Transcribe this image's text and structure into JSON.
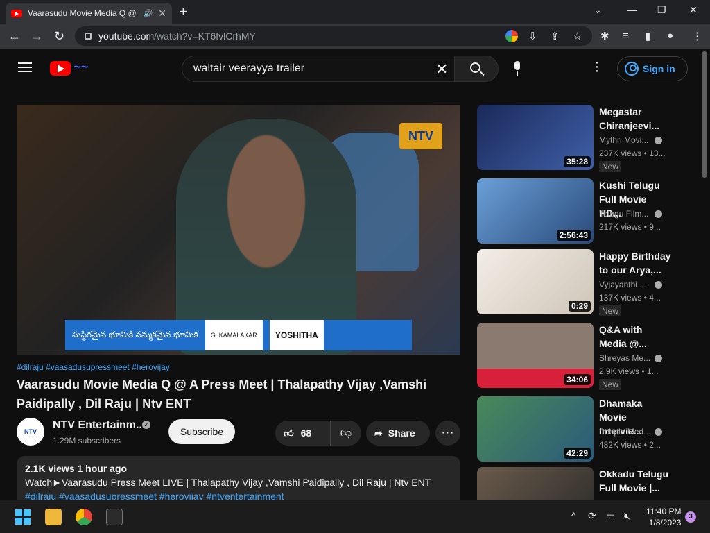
{
  "browser": {
    "tab_title": "Vaarasudu Movie Media Q @",
    "url_host": "youtube.com",
    "url_path": "/watch?v=KT6fvlCrhMY"
  },
  "header": {
    "search_query": "waltair veerayya trailer",
    "sign_in": "Sign in"
  },
  "player": {
    "banner_text": "సుస్థిరమైన భూమికి నమ్మకమైన భూమిక",
    "banner_name": "G. KAMALAKAR",
    "banner_brand": "YOSHITHA",
    "watermark": "NTV"
  },
  "video": {
    "hashtags": "#dilraju #vaasadusupressmeet #herovijay",
    "title": "Vaarasudu Movie Media Q @ A Press Meet | Thalapathy Vijay ,Vamshi Paidipally , Dil Raju | Ntv ENT",
    "channel_name": "NTV Entertainm...",
    "subscribers": "1.29M subscribers",
    "subscribe_label": "Subscribe",
    "likes": "68",
    "share_label": "Share",
    "desc_stats": "2.1K views  1 hour ago",
    "desc_line": "Watch►Vaarasudu Press Meet LIVE |  Thalapathy Vijay ,Vamshi Paidipally , Dil Raju | Ntv ENT",
    "desc_tags": "#dilraju #vaasadusupressmeet #herovijay #ntventertainment"
  },
  "recommendations": [
    {
      "title": "Megastar Chiranjeevi...",
      "channel": "Mythri Movi...",
      "views": "237K views  •  13...",
      "duration": "35:28",
      "badge": "New",
      "thumb_color": "#2b3f7a"
    },
    {
      "title": "Kushi Telugu Full Movie HD...",
      "channel": "Telugu Film...",
      "views": "217K views  •  9...",
      "duration": "2:56:43",
      "badge": "",
      "thumb_color": "#4a7ab8"
    },
    {
      "title": "Happy Birthday to our Arya,...",
      "channel": "Vyjayanthi ...",
      "views": "137K views  •  4...",
      "duration": "0:29",
      "badge": "New",
      "thumb_color": "#e9e4dc"
    },
    {
      "title": "Q&A with Media @...",
      "channel": "Shreyas Me...",
      "views": "2.9K views  •  1...",
      "duration": "34:06",
      "badge": "New",
      "thumb_color": "#d8203a"
    },
    {
      "title": "Dhamaka Movie Intervie...",
      "channel": "People Med...",
      "views": "482K views  •  2...",
      "duration": "42:29",
      "badge": "",
      "thumb_color": "#3a7a4a"
    },
    {
      "title": "Okkadu Telugu Full Movie |...",
      "channel": "",
      "views": "",
      "duration": "",
      "badge": "",
      "thumb_color": "#5a4a3a"
    }
  ],
  "taskbar": {
    "time": "11:40 PM",
    "date": "1/8/2023",
    "notifications": "3"
  }
}
